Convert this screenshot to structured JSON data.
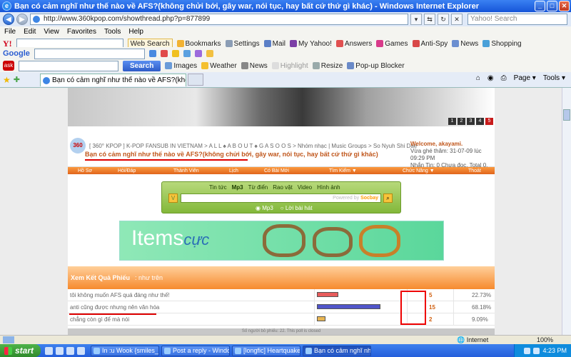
{
  "window": {
    "title": "Bạn có cảm nghĩ như thế nào về AFS?(không chửi bới, gây war, nói tục, hay bất cứ thứ gì khác) - Windows Internet Explorer"
  },
  "address": {
    "url": "http://www.360kpop.com/showthread.php?p=877899",
    "search_placeholder": "Yahoo! Search"
  },
  "menu": [
    "File",
    "Edit",
    "View",
    "Favorites",
    "Tools",
    "Help"
  ],
  "yahoo_toolbar": {
    "web_search": "Web Search",
    "bookmarks": "Bookmarks",
    "settings": "Settings",
    "mail": "Mail",
    "my_yahoo": "My Yahoo!",
    "answers": "Answers",
    "games": "Games",
    "anti_spy": "Anti-Spy",
    "news": "News",
    "shopping": "Shopping"
  },
  "google_toolbar": {
    "label": "Google"
  },
  "ask_toolbar": {
    "search": "Search",
    "images": "Images",
    "weather": "Weather",
    "news": "News",
    "highlight": "Highlight",
    "resize": "Resize",
    "popup_blocker": "Pop-up Blocker"
  },
  "tab": {
    "label": "Bạn có cảm nghĩ như thế nào về AFS?(không chửi bới,...",
    "page": "Page",
    "tools": "Tools"
  },
  "banner_pages": [
    "1",
    "2",
    "3",
    "4",
    "5"
  ],
  "forum": {
    "logo": "360",
    "breadcrumb": "[ 360° KPOP ] K-POP FANSUB IN VIETNAM > A L L ♠ A B O U T ♠ G A S O O S > Nhóm nhạc | Music Groups > So Nyuh Shi Dae",
    "thread_title": "Bạn có cảm nghĩ như thế nào về AFS?(không chửi bới, gây war, nói tục, hay bất cứ thứ gì khác)",
    "welcome": "Welcome, akayami.",
    "last_visit": "Vừa ghé thăm: 31-07-09 lúc 09:29 PM",
    "messages": "Nhắn Tin: 0 Chưa đọc, Total 0."
  },
  "nav": [
    "Hồ Sơ",
    "Hỏi/Đáp",
    "Thành Viên",
    "Lịch",
    "Có Bài Mới",
    "Tìm Kiếm ▼",
    "Chức Năng ▼",
    "Thoát"
  ],
  "music_search": {
    "tabs": [
      "Tin tức",
      "Mp3",
      "Từ điển",
      "Rao vặt",
      "Video",
      "Hình ảnh"
    ],
    "powered": "Powered by ",
    "brand": "Socbay",
    "radio_mp3": "Mp3",
    "radio_lyrics": "Lời bài hát"
  },
  "ad": {
    "text": "Items",
    "accent": "cực"
  },
  "poll": {
    "heading": "Xem Kết Quả Phiếu",
    "sub": ": như trên",
    "options": [
      {
        "text": "tôi không muốn AFS quá đáng như thế!",
        "votes": "5",
        "percent": "22.73%",
        "ratio": 0.2273,
        "color": "#e75b5b"
      },
      {
        "text": "anti cũng được nhưng nên văn hóa",
        "votes": "15",
        "percent": "68.18%",
        "ratio": 0.6818,
        "color": "#4f54c9"
      },
      {
        "text": "chẳng còn gì để mà nói",
        "votes": "2",
        "percent": "9.09%",
        "ratio": 0.0909,
        "color": "#e8b553"
      }
    ],
    "footer": "Số người bỏ phiếu: 22. This poll is closed"
  },
  "status": {
    "zone": "Internet",
    "zoom": "100%"
  },
  "taskbar": {
    "start": "start",
    "tasks": [
      "In :u Wook {smiles_t...",
      "Post a reply - Windo...",
      "[longfic] Heartquake ...",
      "Bạn có cảm nghĩ như ..."
    ],
    "clock": "4:23 PM"
  }
}
